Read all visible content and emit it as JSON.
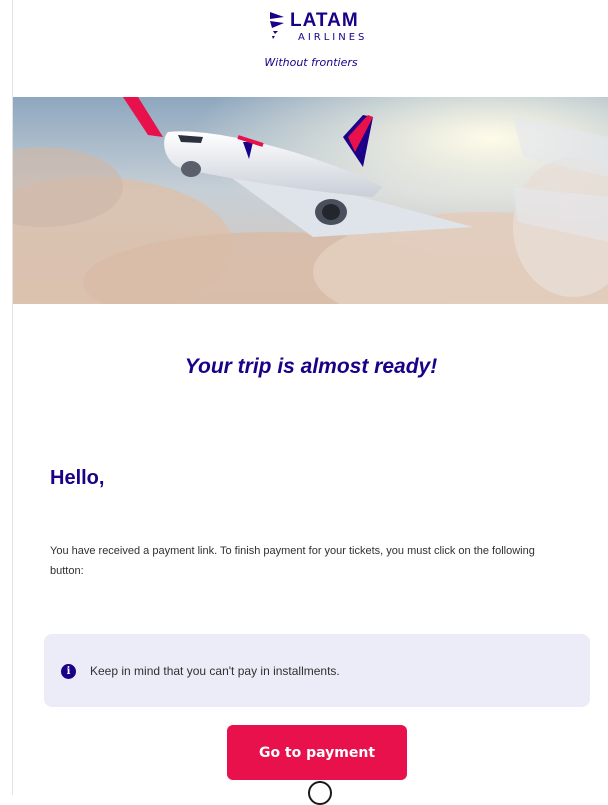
{
  "brand": {
    "logo_word": "LATAM",
    "logo_sub": "AIRLINES",
    "tagline": "Without frontiers",
    "colors": {
      "primary": "#1b0088",
      "accent": "#e8114b",
      "notice_bg": "#ececf8"
    }
  },
  "hero": {
    "image": "airplane-above-clouds"
  },
  "main": {
    "title": "Your trip is almost ready!",
    "greeting": "Hello,",
    "body": "You have received a payment link. To finish payment for your tickets, you must click on the following button:",
    "notice": {
      "icon": "info-icon",
      "text": "Keep in mind that you can't pay in installments."
    },
    "cta_label": "Go to payment"
  }
}
